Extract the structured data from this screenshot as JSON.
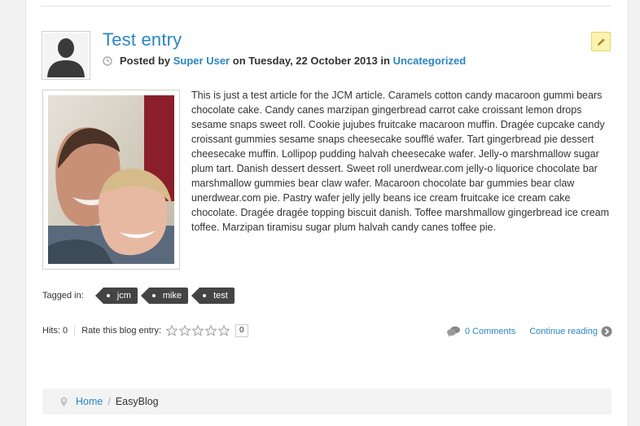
{
  "entry": {
    "title": "Test entry",
    "meta": {
      "posted_by": "Posted by",
      "author": "Super User",
      "on": "on",
      "date": "Tuesday, 22 October 2013",
      "in": "in",
      "category": "Uncategorized"
    },
    "body": "This is just a test article for the JCM article. Caramels cotton candy macaroon gummi bears chocolate cake. Candy canes marzipan gingerbread carrot cake croissant lemon drops sesame snaps sweet roll. Cookie jujubes fruitcake macaroon muffin. Dragée cupcake candy croissant gummies sesame snaps cheesecake soufflé wafer. Tart gingerbread pie dessert cheesecake muffin. Lollipop pudding halvah cheesecake wafer. Jelly-o marshmallow sugar plum tart. Danish dessert dessert. Sweet roll unerdwear.com jelly-o liquorice chocolate bar marshmallow gummies bear claw wafer. Macaroon chocolate bar gummies bear claw unerdwear.com pie. Pastry wafer jelly jelly beans ice cream fruitcake ice cream cake chocolate. Dragée dragée topping biscuit danish. Toffee marshmallow gingerbread ice cream toffee. Marzipan tiramisu sugar plum halvah candy canes toffee pie."
  },
  "tags": {
    "label": "Tagged in:",
    "items": [
      "jcm",
      "mike",
      "test"
    ]
  },
  "footer": {
    "hits": "Hits: 0",
    "rate_label": "Rate this blog entry:",
    "rating_stars": 0,
    "rating_count": "0",
    "comments": "0 Comments",
    "continue": "Continue reading"
  },
  "breadcrumb": {
    "home": "Home",
    "separator": "/",
    "current": "EasyBlog"
  },
  "icons": {
    "clock": "clock-icon",
    "edit": "pencil-icon",
    "comments": "comments-icon",
    "continue": "arrow-right-circle-icon",
    "location": "map-pin-icon"
  },
  "colors": {
    "link": "#2a86c6",
    "tag_bg": "#444444",
    "edit_bg": "#fbf3b0",
    "breadcrumb_bg": "#f3f3f3"
  }
}
